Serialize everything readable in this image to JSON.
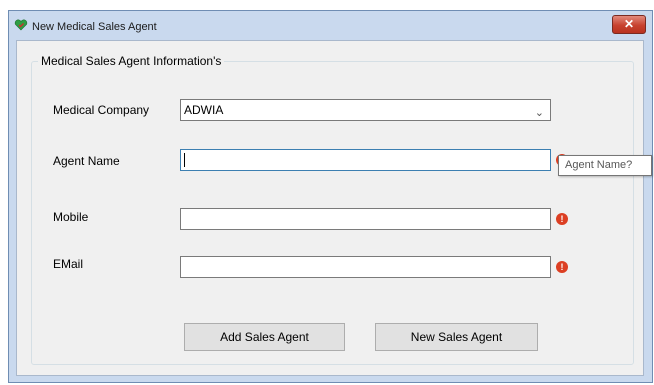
{
  "window": {
    "title": "New Medical Sales Agent",
    "close_symbol": "✕"
  },
  "form": {
    "group_title": "Medical Sales Agent Information's",
    "company": {
      "label": "Medical Company",
      "value": "ADWIA",
      "dropdown_icon": "chevron-down-icon"
    },
    "agent_name": {
      "label": "Agent Name",
      "value": ""
    },
    "mobile": {
      "label": "Mobile",
      "value": ""
    },
    "email": {
      "label": "EMail",
      "value": ""
    },
    "error_symbol": "!",
    "tooltip": "Agent Name?"
  },
  "buttons": {
    "add": "Add Sales Agent",
    "new": "New Sales Agent"
  },
  "colors": {
    "frame": "#c9d9ee",
    "close_button": "#c7412f",
    "error_icon": "#dc3f23",
    "focus_border": "#3c7fb1"
  }
}
